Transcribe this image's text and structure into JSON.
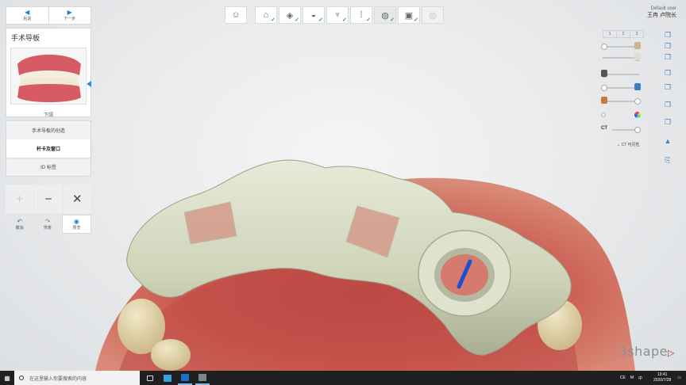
{
  "nav": {
    "back_label": "后退",
    "next_label": "下一步"
  },
  "panel": {
    "title": "手术导板",
    "thumb_label": "下颌",
    "steps": [
      {
        "label": "手术导板的创造",
        "active": false
      },
      {
        "label": "杆卡及窗口",
        "active": true
      },
      {
        "label": "ID 标签",
        "active": false
      }
    ]
  },
  "tools": {
    "add": "+",
    "remove": "−",
    "close": "✕"
  },
  "actions": {
    "undo_label": "撤消",
    "redo_label": "恢复",
    "preview_label": "预览"
  },
  "toolbar": {
    "steps": [
      {
        "icon": "patient-photo-icon",
        "done": false
      },
      {
        "icon": "scan-icon",
        "done": true
      },
      {
        "icon": "model-icon",
        "done": true
      },
      {
        "icon": "crown-icon",
        "done": true
      },
      {
        "icon": "tooth-icon",
        "done": true
      },
      {
        "icon": "implant-icon",
        "done": true
      },
      {
        "icon": "guide-icon",
        "done": true,
        "active": true
      },
      {
        "icon": "export-icon",
        "done": true
      },
      {
        "icon": "final-icon",
        "done": false
      }
    ]
  },
  "user": {
    "line1": "Default user",
    "line2": "王冉 卢院长"
  },
  "right_panel": {
    "tabs": [
      "1",
      "2",
      "3"
    ],
    "ct_label": "CT",
    "ct_visible_label": "CT 可见性"
  },
  "brand": {
    "text": "3shape"
  },
  "taskbar": {
    "search_placeholder": "在这里输入你要搜索的内容",
    "time": "13:41",
    "date": "2020/7/28",
    "lang": "CE",
    "ime": "M",
    "ime2": "中"
  },
  "colors": {
    "accent": "#2a7fc0",
    "check": "#37a13a",
    "brand_red": "#c8282a",
    "guide": "#d9dcc6",
    "gum": "#c9584f"
  }
}
